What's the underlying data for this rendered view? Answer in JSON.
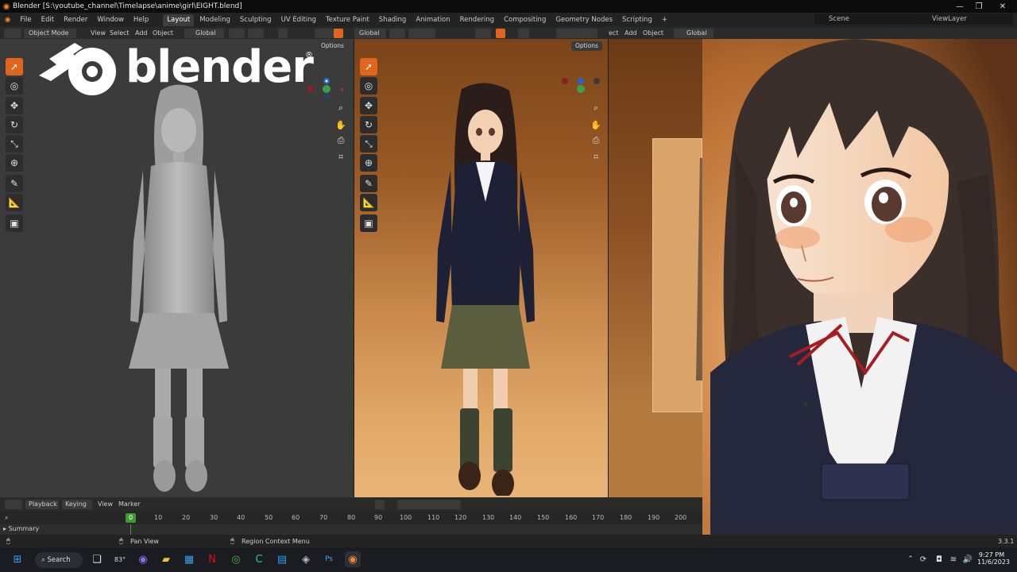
{
  "window": {
    "title": "Blender [S:\\youtube_channel\\Timelapse\\anime\\girl\\EIGHT.blend]",
    "controls": [
      "—",
      "❐",
      "✕"
    ]
  },
  "menu": [
    "File",
    "Edit",
    "Render",
    "Window",
    "Help"
  ],
  "workspaces": [
    "Layout",
    "Modeling",
    "Sculpting",
    "UV Editing",
    "Texture Paint",
    "Shading",
    "Animation",
    "Rendering",
    "Compositing",
    "Geometry Nodes",
    "Scripting"
  ],
  "active_workspace": "Layout",
  "add_workspace": "+",
  "scene": "Scene",
  "view_layer": "ViewLayer",
  "viewport_header": {
    "mode": "Object Mode",
    "view": "View",
    "select": "Select",
    "add": "Add",
    "object": "Object",
    "transform_orientation": "Global",
    "vp2_orientation": "Global",
    "vp3_view_partial": "ect",
    "vp3_add": "Add",
    "vp3_object": "Object",
    "vp3_orientation": "Global"
  },
  "options_label": "Options",
  "logo": {
    "wordmark": "blender",
    "registered": "®"
  },
  "timeline": {
    "playback": "Playback",
    "keying": "Keying",
    "view": "View",
    "marker": "Marker",
    "current_frame": "0",
    "ticks": [
      "10",
      "20",
      "30",
      "40",
      "50",
      "60",
      "70",
      "80",
      "90",
      "100",
      "110",
      "120",
      "130",
      "140",
      "150",
      "160",
      "170",
      "180",
      "190",
      "200"
    ],
    "summary": "Summary"
  },
  "status": {
    "pan_view": "Pan View",
    "region_context_menu": "Region Context Menu",
    "version": "3.3.1"
  },
  "taskbar": {
    "search": "Search",
    "temperature": "83°",
    "time": "9:27 PM",
    "date": "11/6/2023"
  },
  "colors": {
    "accent": "#e2651e",
    "active_tab": "#3d3d3d",
    "timeline_playhead": "#3f9a2f"
  }
}
